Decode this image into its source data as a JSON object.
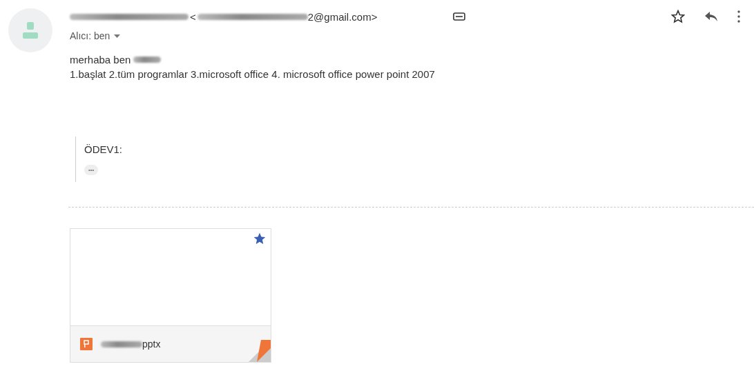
{
  "header": {
    "sender_open": "<",
    "sender_email_tail": "2@gmail.com>",
    "recipient": "Alıcı: ben"
  },
  "body": {
    "greeting": "merhaba ben",
    "line": "1.başlat 2.tüm programlar 3.microsoft office 4. microsoft office power point 2007"
  },
  "quote": {
    "title": "ÖDEV1:",
    "more": "•••"
  },
  "attachment": {
    "name": "pptx",
    "starred": true
  }
}
